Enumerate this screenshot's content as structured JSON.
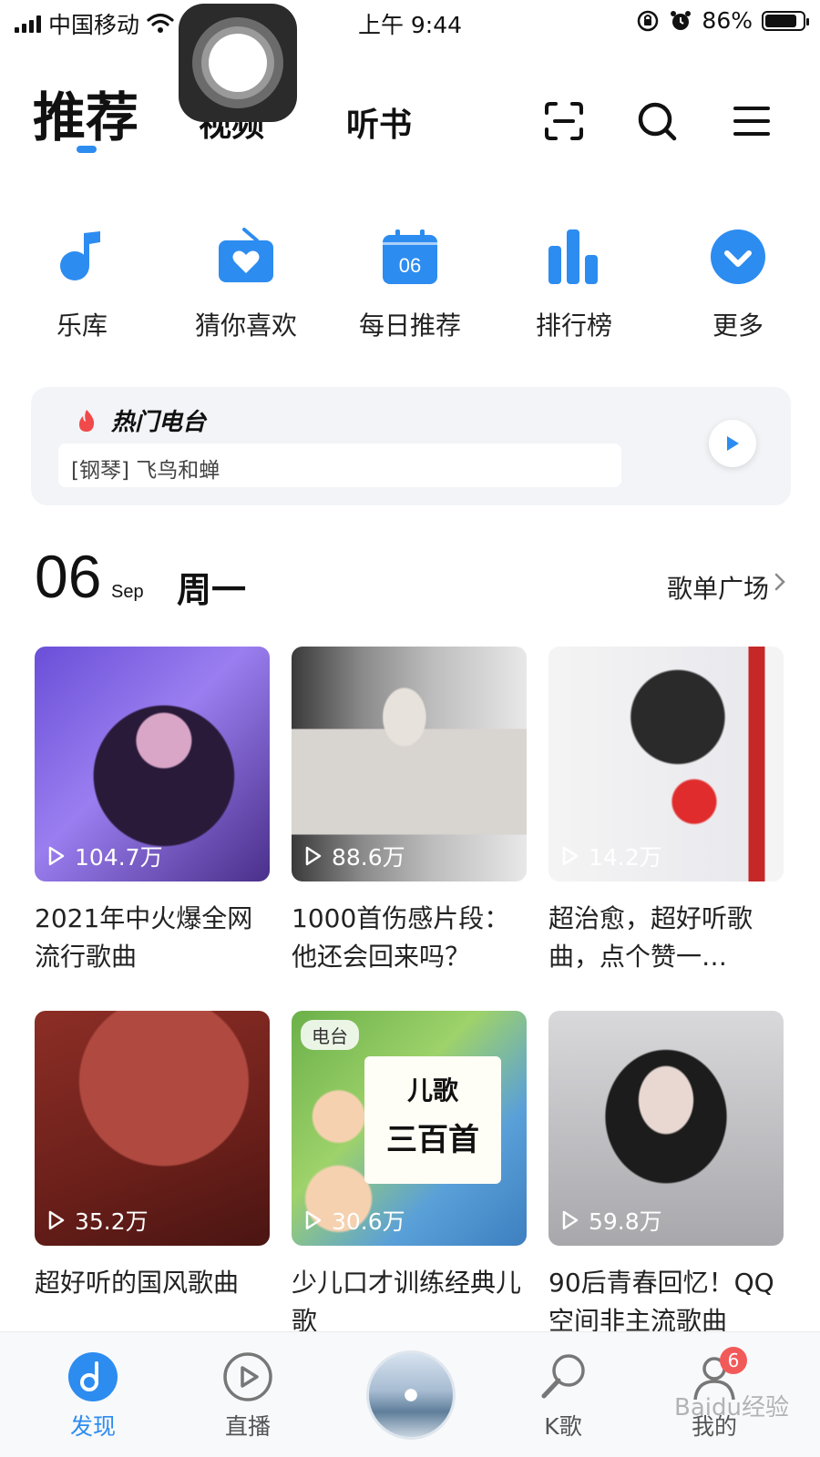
{
  "status_bar": {
    "carrier": "中国移动",
    "time": "上午 9:44",
    "battery": "86%",
    "battery_level": 0.86
  },
  "top_tabs": {
    "active": "推荐",
    "tab2": "视频",
    "tab3": "听书"
  },
  "top_icons": [
    "scan-icon",
    "search-icon",
    "menu-icon"
  ],
  "quick_entries": [
    {
      "label": "乐库",
      "icon": "music-note-icon"
    },
    {
      "label": "猜你喜欢",
      "icon": "radio-heart-icon"
    },
    {
      "label": "每日推荐",
      "icon": "calendar-icon",
      "day": "06"
    },
    {
      "label": "排行榜",
      "icon": "bar-chart-icon"
    },
    {
      "label": "更多",
      "icon": "chevron-down-circle-icon"
    }
  ],
  "hot_radio": {
    "title": "热门电台",
    "now_playing": "[钢琴] 飞鸟和蝉"
  },
  "date_header": {
    "day": "06",
    "month": "Sep",
    "weekday": "周一",
    "link": "歌单广场"
  },
  "playlists": [
    {
      "plays": "104.7万",
      "title": "2021年中火爆全网流行歌曲"
    },
    {
      "plays": "88.6万",
      "title": "1000首伤感片段：他还会回来吗？"
    },
    {
      "plays": "14.2万",
      "title": "超治愈，超好听歌曲，点个赞一…"
    },
    {
      "plays": "35.2万",
      "title": "超好听的国风歌曲"
    },
    {
      "plays": "30.6万",
      "title": "少儿口才训练经典儿歌",
      "badge": "电台",
      "cover_text_1": "儿歌",
      "cover_text_2": "三百首"
    },
    {
      "plays": "59.8万",
      "title": "90后青春回忆！QQ空间非主流歌曲"
    }
  ],
  "bottom_nav": [
    {
      "label": "发现",
      "active": true
    },
    {
      "label": "直播"
    },
    {
      "label": ""
    },
    {
      "label": "K歌"
    },
    {
      "label": "我的",
      "badge": "6"
    }
  ],
  "watermark": "Baidu经验",
  "colors": {
    "accent": "#2d8cf0",
    "hot": "#f04a4a",
    "badge": "#f25a5a"
  }
}
